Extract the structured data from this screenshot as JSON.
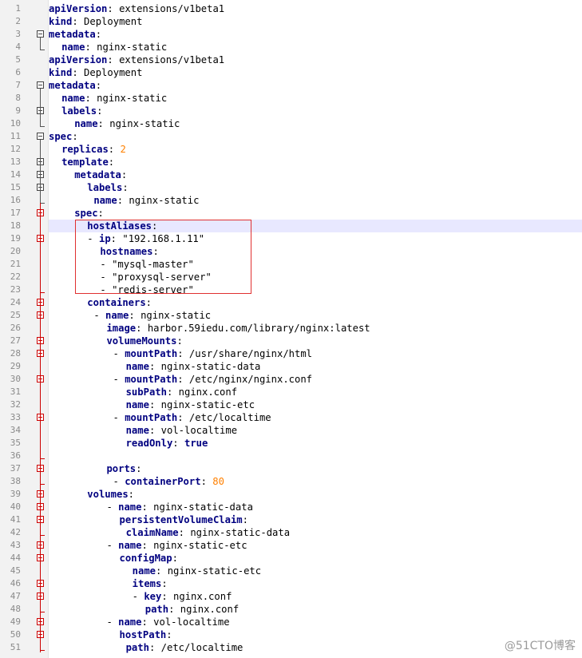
{
  "editor": {
    "lines": [
      {
        "n": "1",
        "indent": 0,
        "tokens": [
          [
            "key",
            "apiVersion"
          ],
          [
            "sep",
            ": "
          ],
          [
            "val",
            "extensions/v1beta1"
          ]
        ]
      },
      {
        "n": "2",
        "indent": 0,
        "tokens": [
          [
            "key",
            "kind"
          ],
          [
            "sep",
            ": "
          ],
          [
            "val",
            "Deployment"
          ]
        ]
      },
      {
        "n": "3",
        "indent": 0,
        "tokens": [
          [
            "key",
            "metadata"
          ],
          [
            "sep",
            ":"
          ]
        ],
        "fold": "black"
      },
      {
        "n": "4",
        "indent": 2,
        "tokens": [
          [
            "key",
            "name"
          ],
          [
            "sep",
            ": "
          ],
          [
            "val",
            "nginx-static"
          ]
        ]
      },
      {
        "n": "5",
        "indent": 0,
        "tokens": [
          [
            "key",
            "apiVersion"
          ],
          [
            "sep",
            ": "
          ],
          [
            "val",
            "extensions/v1beta1"
          ]
        ]
      },
      {
        "n": "6",
        "indent": 0,
        "tokens": [
          [
            "key",
            "kind"
          ],
          [
            "sep",
            ": "
          ],
          [
            "val",
            "Deployment"
          ]
        ]
      },
      {
        "n": "7",
        "indent": 0,
        "tokens": [
          [
            "key",
            "metadata"
          ],
          [
            "sep",
            ":"
          ]
        ],
        "fold": "black"
      },
      {
        "n": "8",
        "indent": 2,
        "tokens": [
          [
            "key",
            "name"
          ],
          [
            "sep",
            ": "
          ],
          [
            "val",
            "nginx-static"
          ]
        ]
      },
      {
        "n": "9",
        "indent": 2,
        "tokens": [
          [
            "key",
            "labels"
          ],
          [
            "sep",
            ":"
          ]
        ],
        "fold": "black"
      },
      {
        "n": "10",
        "indent": 4,
        "tokens": [
          [
            "key",
            "name"
          ],
          [
            "sep",
            ": "
          ],
          [
            "val",
            "nginx-static"
          ]
        ]
      },
      {
        "n": "11",
        "indent": 0,
        "tokens": [
          [
            "key",
            "spec"
          ],
          [
            "sep",
            ":"
          ]
        ],
        "fold": "black"
      },
      {
        "n": "12",
        "indent": 2,
        "tokens": [
          [
            "key",
            "replicas"
          ],
          [
            "sep",
            ": "
          ],
          [
            "num",
            "2"
          ]
        ]
      },
      {
        "n": "13",
        "indent": 2,
        "tokens": [
          [
            "key",
            "template"
          ],
          [
            "sep",
            ":"
          ]
        ],
        "fold": "black"
      },
      {
        "n": "14",
        "indent": 4,
        "tokens": [
          [
            "key",
            "metadata"
          ],
          [
            "sep",
            ":"
          ]
        ],
        "fold": "black"
      },
      {
        "n": "15",
        "indent": 6,
        "tokens": [
          [
            "key",
            "labels"
          ],
          [
            "sep",
            ":"
          ]
        ],
        "fold": "black"
      },
      {
        "n": "16",
        "indent": 7,
        "tokens": [
          [
            "key",
            "name"
          ],
          [
            "sep",
            ": "
          ],
          [
            "val",
            "nginx-static"
          ]
        ]
      },
      {
        "n": "17",
        "indent": 4,
        "tokens": [
          [
            "key",
            "spec"
          ],
          [
            "sep",
            ":"
          ]
        ],
        "fold": "red"
      },
      {
        "n": "18",
        "indent": 6,
        "tokens": [
          [
            "key",
            "hostAliases"
          ],
          [
            "sep",
            ":"
          ]
        ],
        "highlight": true
      },
      {
        "n": "19",
        "indent": 6,
        "tokens": [
          [
            "dash",
            "- "
          ],
          [
            "key",
            "ip"
          ],
          [
            "sep",
            ": "
          ],
          [
            "str",
            "\"192.168.1.11\""
          ]
        ],
        "fold": "red"
      },
      {
        "n": "20",
        "indent": 8,
        "tokens": [
          [
            "key",
            "hostnames"
          ],
          [
            "sep",
            ":"
          ]
        ]
      },
      {
        "n": "21",
        "indent": 8,
        "tokens": [
          [
            "dash",
            "- "
          ],
          [
            "str",
            "\"mysql-master\""
          ]
        ]
      },
      {
        "n": "22",
        "indent": 8,
        "tokens": [
          [
            "dash",
            "- "
          ],
          [
            "str",
            "\"proxysql-server\""
          ]
        ]
      },
      {
        "n": "23",
        "indent": 8,
        "tokens": [
          [
            "dash",
            "- "
          ],
          [
            "str",
            "\"redis-server\""
          ]
        ]
      },
      {
        "n": "24",
        "indent": 6,
        "tokens": [
          [
            "key",
            "containers"
          ],
          [
            "sep",
            ":"
          ]
        ],
        "fold": "red"
      },
      {
        "n": "25",
        "indent": 7,
        "tokens": [
          [
            "dash",
            "- "
          ],
          [
            "key",
            "name"
          ],
          [
            "sep",
            ": "
          ],
          [
            "val",
            "nginx-static"
          ]
        ],
        "fold": "red"
      },
      {
        "n": "26",
        "indent": 9,
        "tokens": [
          [
            "key",
            "image"
          ],
          [
            "sep",
            ": "
          ],
          [
            "val",
            "harbor.59iedu.com/library/nginx:latest"
          ]
        ]
      },
      {
        "n": "27",
        "indent": 9,
        "tokens": [
          [
            "key",
            "volumeMounts"
          ],
          [
            "sep",
            ":"
          ]
        ],
        "fold": "red"
      },
      {
        "n": "28",
        "indent": 10,
        "tokens": [
          [
            "dash",
            "- "
          ],
          [
            "key",
            "mountPath"
          ],
          [
            "sep",
            ": "
          ],
          [
            "val",
            "/usr/share/nginx/html"
          ]
        ],
        "fold": "red"
      },
      {
        "n": "29",
        "indent": 12,
        "tokens": [
          [
            "key",
            "name"
          ],
          [
            "sep",
            ": "
          ],
          [
            "val",
            "nginx-static-data"
          ]
        ]
      },
      {
        "n": "30",
        "indent": 10,
        "tokens": [
          [
            "dash",
            "- "
          ],
          [
            "key",
            "mountPath"
          ],
          [
            "sep",
            ": "
          ],
          [
            "val",
            "/etc/nginx/nginx.conf"
          ]
        ],
        "fold": "red"
      },
      {
        "n": "31",
        "indent": 12,
        "tokens": [
          [
            "key",
            "subPath"
          ],
          [
            "sep",
            ": "
          ],
          [
            "val",
            "nginx.conf"
          ]
        ]
      },
      {
        "n": "32",
        "indent": 12,
        "tokens": [
          [
            "key",
            "name"
          ],
          [
            "sep",
            ": "
          ],
          [
            "val",
            "nginx-static-etc"
          ]
        ]
      },
      {
        "n": "33",
        "indent": 10,
        "tokens": [
          [
            "dash",
            "- "
          ],
          [
            "key",
            "mountPath"
          ],
          [
            "sep",
            ": "
          ],
          [
            "val",
            "/etc/localtime"
          ]
        ],
        "fold": "red"
      },
      {
        "n": "34",
        "indent": 12,
        "tokens": [
          [
            "key",
            "name"
          ],
          [
            "sep",
            ": "
          ],
          [
            "val",
            "vol-localtime"
          ]
        ]
      },
      {
        "n": "35",
        "indent": 12,
        "tokens": [
          [
            "key",
            "readOnly"
          ],
          [
            "sep",
            ": "
          ],
          [
            "boolv",
            "true"
          ]
        ]
      },
      {
        "n": "36",
        "indent": 0,
        "tokens": []
      },
      {
        "n": "37",
        "indent": 9,
        "tokens": [
          [
            "key",
            "ports"
          ],
          [
            "sep",
            ":"
          ]
        ],
        "fold": "red"
      },
      {
        "n": "38",
        "indent": 10,
        "tokens": [
          [
            "dash",
            "- "
          ],
          [
            "key",
            "containerPort"
          ],
          [
            "sep",
            ": "
          ],
          [
            "num",
            "80"
          ]
        ]
      },
      {
        "n": "39",
        "indent": 6,
        "tokens": [
          [
            "key",
            "volumes"
          ],
          [
            "sep",
            ":"
          ]
        ],
        "fold": "red"
      },
      {
        "n": "40",
        "indent": 9,
        "tokens": [
          [
            "dash",
            "- "
          ],
          [
            "key",
            "name"
          ],
          [
            "sep",
            ": "
          ],
          [
            "val",
            "nginx-static-data"
          ]
        ],
        "fold": "red"
      },
      {
        "n": "41",
        "indent": 11,
        "tokens": [
          [
            "key",
            "persistentVolumeClaim"
          ],
          [
            "sep",
            ":"
          ]
        ],
        "fold": "red"
      },
      {
        "n": "42",
        "indent": 12,
        "tokens": [
          [
            "key",
            "claimName"
          ],
          [
            "sep",
            ": "
          ],
          [
            "val",
            "nginx-static-data"
          ]
        ]
      },
      {
        "n": "43",
        "indent": 9,
        "tokens": [
          [
            "dash",
            "- "
          ],
          [
            "key",
            "name"
          ],
          [
            "sep",
            ": "
          ],
          [
            "val",
            "nginx-static-etc"
          ]
        ],
        "fold": "red"
      },
      {
        "n": "44",
        "indent": 11,
        "tokens": [
          [
            "key",
            "configMap"
          ],
          [
            "sep",
            ":"
          ]
        ],
        "fold": "red"
      },
      {
        "n": "45",
        "indent": 13,
        "tokens": [
          [
            "key",
            "name"
          ],
          [
            "sep",
            ": "
          ],
          [
            "val",
            "nginx-static-etc"
          ]
        ]
      },
      {
        "n": "46",
        "indent": 13,
        "tokens": [
          [
            "key",
            "items"
          ],
          [
            "sep",
            ":"
          ]
        ],
        "fold": "red"
      },
      {
        "n": "47",
        "indent": 13,
        "tokens": [
          [
            "dash",
            "- "
          ],
          [
            "key",
            "key"
          ],
          [
            "sep",
            ": "
          ],
          [
            "val",
            "nginx.conf"
          ]
        ],
        "fold": "red"
      },
      {
        "n": "48",
        "indent": 15,
        "tokens": [
          [
            "key",
            "path"
          ],
          [
            "sep",
            ": "
          ],
          [
            "val",
            "nginx.conf"
          ]
        ]
      },
      {
        "n": "49",
        "indent": 9,
        "tokens": [
          [
            "dash",
            "- "
          ],
          [
            "key",
            "name"
          ],
          [
            "sep",
            ": "
          ],
          [
            "val",
            "vol-localtime"
          ]
        ],
        "fold": "red"
      },
      {
        "n": "50",
        "indent": 11,
        "tokens": [
          [
            "key",
            "hostPath"
          ],
          [
            "sep",
            ":"
          ]
        ],
        "fold": "red"
      },
      {
        "n": "51",
        "indent": 12,
        "tokens": [
          [
            "key",
            "path"
          ],
          [
            "sep",
            ": "
          ],
          [
            "val",
            "/etc/localtime"
          ]
        ]
      }
    ]
  },
  "colors": {
    "key": "#000080",
    "number": "#ff8000",
    "fold_red": "#cc0000",
    "highlight": "#e8e8ff",
    "annotation_box": "#e03030"
  },
  "watermark": "@51CTO博客"
}
